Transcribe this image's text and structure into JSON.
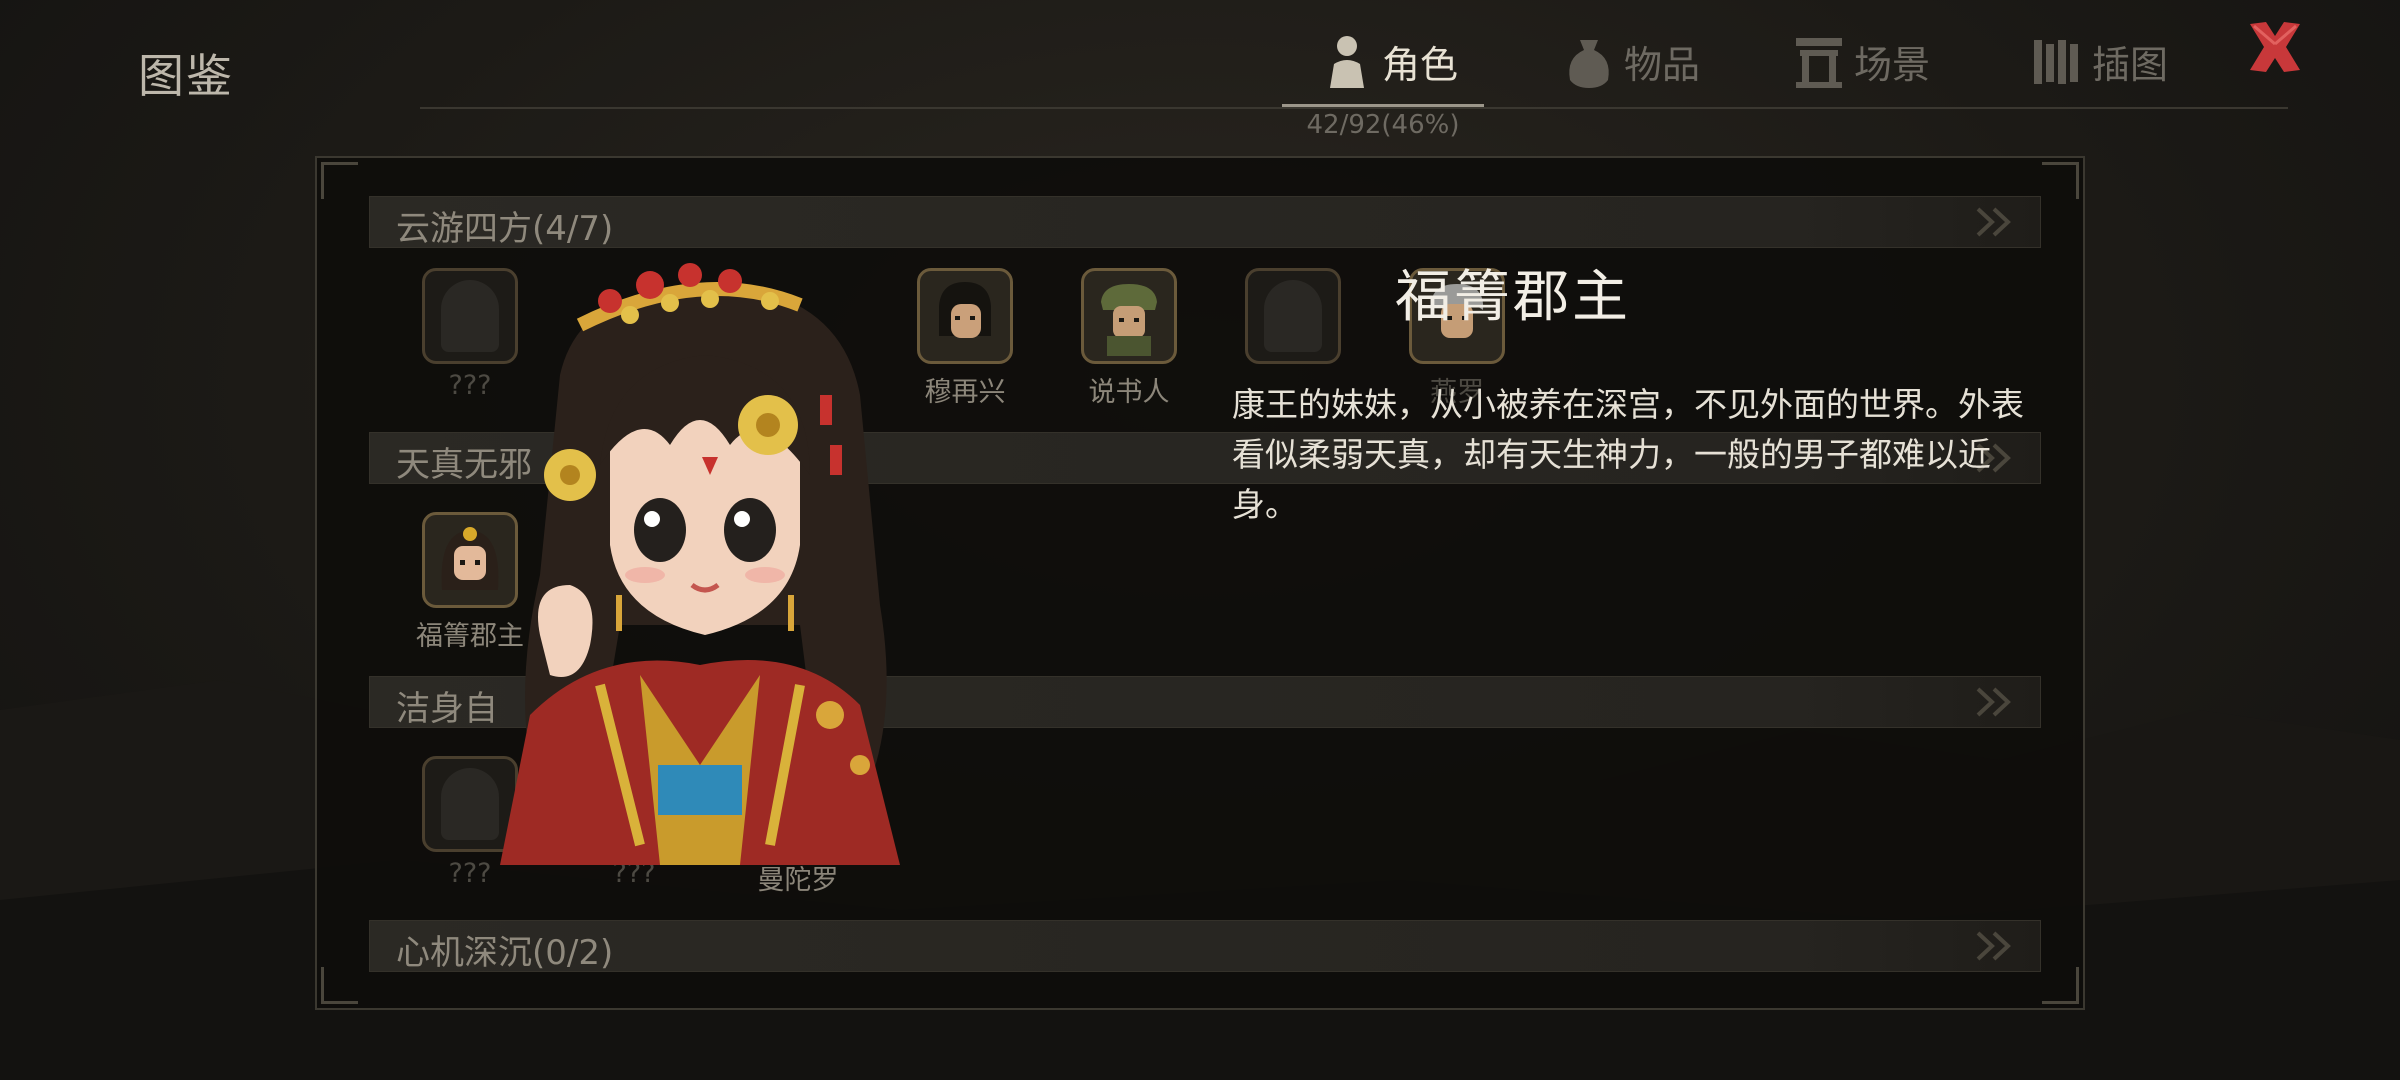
{
  "header": {
    "title": "图鉴"
  },
  "tabs": [
    {
      "label": "角色",
      "icon": "character-icon",
      "active": true
    },
    {
      "label": "物品",
      "icon": "item-bag-icon",
      "active": false
    },
    {
      "label": "场景",
      "icon": "scene-gate-icon",
      "active": false
    },
    {
      "label": "插图",
      "icon": "illustration-scroll-icon",
      "active": false
    }
  ],
  "progress": "42/92(46%)",
  "sections": [
    {
      "title": "云游四方(4/7)",
      "characters": [
        "???",
        "",
        "",
        "穆再兴",
        "说书人",
        "",
        "燕罗"
      ]
    },
    {
      "title": "天真无邪",
      "characters": [
        "福箐郡主"
      ]
    },
    {
      "title": "洁身自",
      "characters": [
        "???",
        "???",
        "曼陀罗"
      ]
    },
    {
      "title": "心机深沉(0/2)",
      "characters": []
    }
  ],
  "detail": {
    "name": "福箐郡主",
    "description": "康王的妹妹，从小被养在深宫，不见外面的世界。外表看似柔弱天真，却有天生神力，一般的男子都难以近身。"
  },
  "colors": {
    "accent_close": "#c8383a",
    "text_primary": "#f2eee6",
    "text_muted": "#8c867a"
  }
}
